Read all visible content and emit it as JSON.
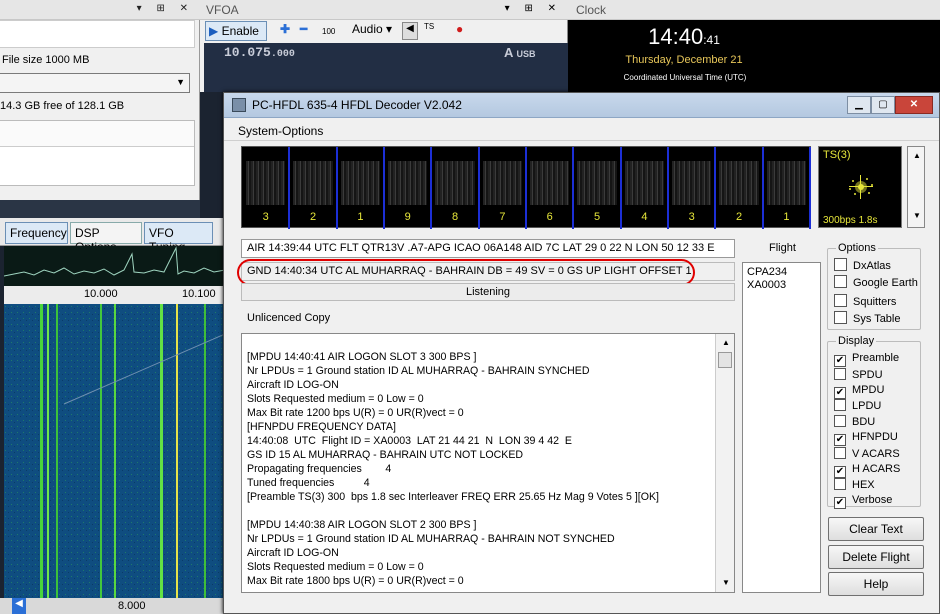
{
  "left_panel": {
    "file_size": "File size 1000 MB",
    "free_space": "14.3 GB free of 128.1 GB",
    "tabs": [
      "Frequency",
      "DSP Options",
      "VFO Tuning"
    ],
    "freq_labels": [
      "10.000",
      "10.100"
    ],
    "bottom_label": "8.000"
  },
  "vfoa": {
    "title": "VFOA",
    "enable_label": "Enable",
    "audio_label": "Audio",
    "step_label": "100",
    "frequency_main": "10.075",
    "frequency_fraction": ".000",
    "mode_letter": "A",
    "mode": "USB"
  },
  "clock": {
    "title": "Clock",
    "time_main": "14:40",
    "time_seconds": ":41",
    "date": "Thursday, December 21",
    "zone": "Coordinated Universal Time (UTC)"
  },
  "dialog": {
    "title": "PC-HFDL 635-4 HFDL Decoder V2.042",
    "menu": "System-Options",
    "slot_numbers": [
      "3",
      "2",
      "1",
      "9",
      "8",
      "7",
      "6",
      "5",
      "4",
      "3",
      "2",
      "1"
    ],
    "ts_label": "TS(3)",
    "ts_rate": "300bps 1.8s",
    "air_line": "AIR 14:39:44  UTC FLT QTR13V .A7-APG ICAO 06A148 AID 7C LAT 29 0 22  N  LON 50 12 33  E",
    "gnd_line": "GND 14:40:34 UTC AL MUHARRAQ - BAHRAIN  DB = 49  SV = 0  GS UP LIGHT  OFFSET 1",
    "status": "Listening",
    "licence": "Unlicenced Copy",
    "log_lines": [
      "[MPDU 14:40:41 AIR LOGON SLOT 3 300 BPS ]",
      "Nr LPDUs = 1 Ground station ID AL MUHARRAQ - BAHRAIN SYNCHED",
      "Aircraft ID LOG-ON",
      "Slots Requested medium = 0 Low = 0",
      "Max Bit rate 1200 bps U(R) = 0 UR(R)vect = 0",
      "[HFNPDU FREQUENCY DATA]",
      "14:40:08  UTC  Flight ID = XA0003  LAT 21 44 21  N  LON 39 4 42  E",
      "GS ID 15 AL MUHARRAQ - BAHRAIN UTC NOT LOCKED",
      "Propagating frequencies        4",
      "Tuned frequencies          4",
      "[Preamble TS(3) 300  bps 1.8 sec Interleaver FREQ ERR 25.65 Hz Mag 9 Votes 5 ][OK]",
      "",
      "[MPDU 14:40:38 AIR LOGON SLOT 2 300 BPS ]",
      "Nr LPDUs = 1 Ground station ID AL MUHARRAQ - BAHRAIN NOT SYNCHED",
      "Aircraft ID LOG-ON",
      "Slots Requested medium = 0 Low = 0",
      "Max Bit rate 1800 bps U(R) = 0 UR(R)vect = 0"
    ],
    "flight_label": "Flight",
    "flights": [
      "CPA234",
      "XA0003"
    ],
    "options": {
      "label": "Options",
      "items": [
        {
          "label": "DxAtlas",
          "checked": false
        },
        {
          "label": "Google Earth",
          "checked": false
        },
        {
          "label": "Squitters",
          "checked": false
        },
        {
          "label": "Sys Table",
          "checked": false
        }
      ]
    },
    "display": {
      "label": "Display",
      "items": [
        {
          "label": "Preamble",
          "checked": true
        },
        {
          "label": "SPDU",
          "checked": false
        },
        {
          "label": "MPDU",
          "checked": true
        },
        {
          "label": "LPDU",
          "checked": false
        },
        {
          "label": "BDU",
          "checked": false
        },
        {
          "label": "HFNPDU",
          "checked": true
        },
        {
          "label": "V ACARS",
          "checked": false
        },
        {
          "label": "H ACARS",
          "checked": true
        },
        {
          "label": "HEX",
          "checked": false
        },
        {
          "label": "Verbose",
          "checked": true
        }
      ]
    },
    "buttons": {
      "clear_text": "Clear Text",
      "delete_flight": "Delete Flight",
      "help": "Help"
    }
  }
}
